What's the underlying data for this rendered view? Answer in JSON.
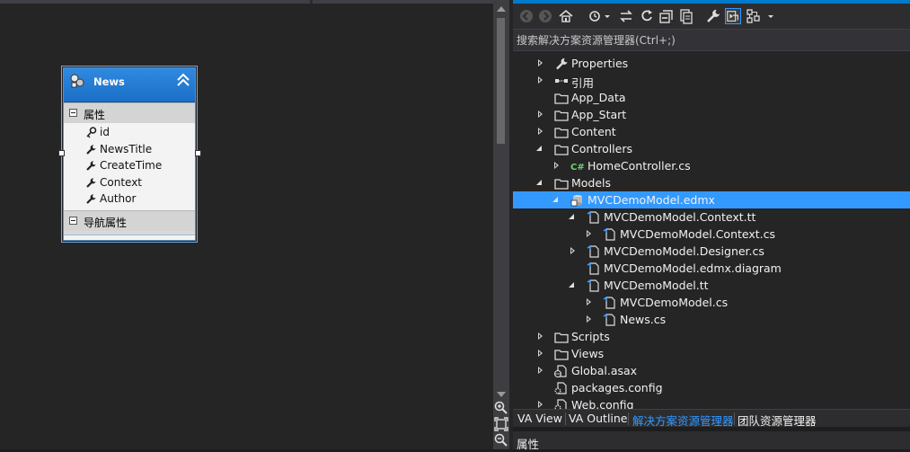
{
  "designer": {
    "entity": {
      "name": "News",
      "properties_section": "属性",
      "properties": [
        {
          "name": "id",
          "icon": "key-icon"
        },
        {
          "name": "NewsTitle",
          "icon": "wrench-icon"
        },
        {
          "name": "CreateTime",
          "icon": "wrench-icon"
        },
        {
          "name": "Context",
          "icon": "wrench-icon"
        },
        {
          "name": "Author",
          "icon": "wrench-icon"
        }
      ],
      "nav_section": "导航属性"
    }
  },
  "solution_explorer": {
    "search_placeholder": "搜索解决方案资源管理器(Ctrl+;)",
    "tree": [
      {
        "label": "Properties",
        "icon": "wrench-icon",
        "arrow": "collapsed",
        "level": 0
      },
      {
        "label": "引用",
        "icon": "references-icon",
        "arrow": "collapsed",
        "level": 0
      },
      {
        "label": "App_Data",
        "icon": "folder-icon",
        "arrow": "none",
        "level": 0
      },
      {
        "label": "App_Start",
        "icon": "folder-icon",
        "arrow": "collapsed",
        "level": 0
      },
      {
        "label": "Content",
        "icon": "folder-icon",
        "arrow": "collapsed",
        "level": 0
      },
      {
        "label": "Controllers",
        "icon": "folder-icon",
        "arrow": "expanded",
        "level": 0
      },
      {
        "label": "HomeController.cs",
        "icon": "csharp-file-icon",
        "arrow": "collapsed",
        "level": 1
      },
      {
        "label": "Models",
        "icon": "folder-icon",
        "arrow": "expanded",
        "level": 0
      },
      {
        "label": "MVCDemoModel.edmx",
        "icon": "edmx-icon",
        "arrow": "expanded",
        "level": 1,
        "selected": true
      },
      {
        "label": "MVCDemoModel.Context.tt",
        "icon": "file-icon",
        "arrow": "expanded",
        "level": 2
      },
      {
        "label": "MVCDemoModel.Context.cs",
        "icon": "file-icon",
        "arrow": "collapsed",
        "level": 3
      },
      {
        "label": "MVCDemoModel.Designer.cs",
        "icon": "file-icon",
        "arrow": "collapsed",
        "level": 2
      },
      {
        "label": "MVCDemoModel.edmx.diagram",
        "icon": "file-icon",
        "arrow": "none",
        "level": 2
      },
      {
        "label": "MVCDemoModel.tt",
        "icon": "file-icon",
        "arrow": "expanded",
        "level": 2
      },
      {
        "label": "MVCDemoModel.cs",
        "icon": "file-icon",
        "arrow": "collapsed",
        "level": 3
      },
      {
        "label": "News.cs",
        "icon": "file-icon",
        "arrow": "collapsed",
        "level": 3
      },
      {
        "label": "Scripts",
        "icon": "folder-icon",
        "arrow": "collapsed",
        "level": 0
      },
      {
        "label": "Views",
        "icon": "folder-icon",
        "arrow": "collapsed",
        "level": 0
      },
      {
        "label": "Global.asax",
        "icon": "global-file-icon",
        "arrow": "collapsed",
        "level": 0
      },
      {
        "label": "packages.config",
        "icon": "config-file-icon",
        "arrow": "none",
        "level": 0
      },
      {
        "label": "Web.config",
        "icon": "config-file-icon",
        "arrow": "collapsed",
        "level": 0
      }
    ],
    "bottom_tabs": [
      {
        "label": "VA View",
        "active": false
      },
      {
        "label": "VA Outline",
        "active": false
      },
      {
        "label": "解决方案资源管理器",
        "active": true
      },
      {
        "label": "团队资源管理器",
        "active": false
      }
    ],
    "properties_panel_title": "属性"
  },
  "colors": {
    "accent": "#007acc",
    "selection": "#3399ff",
    "background": "#252526",
    "entity_header": "#1b6fc6"
  }
}
